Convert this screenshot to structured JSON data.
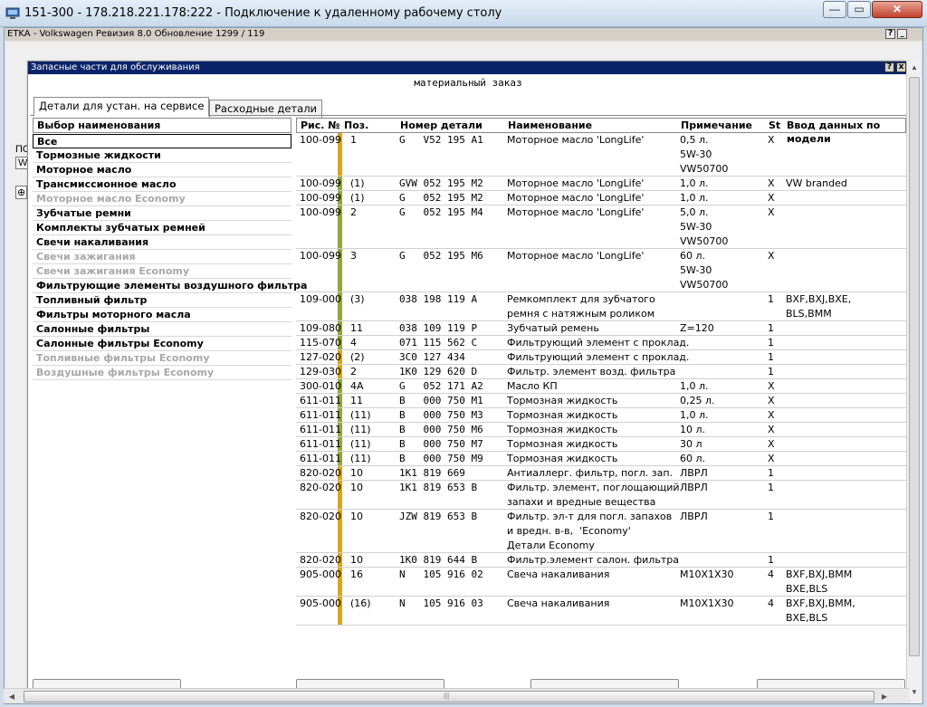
{
  "rdp": {
    "title": "151-300 - 178.218.221.178:222 - Подключение к удаленному рабочему столу",
    "buttons": {
      "minimize": "—",
      "maximize": "▭",
      "close": "✕"
    }
  },
  "etka": {
    "title": "ETKA - Volkswagen Ревизия 8.0 Обновление 1299 / 119",
    "help": "?",
    "minimize": "_",
    "bg_fragments": [
      "ПС",
      "W",
      "⊕"
    ]
  },
  "dialog": {
    "title": "Запасные части для обслуживания",
    "help": "?",
    "close": "x",
    "heading": "материальный заказ",
    "tabs": [
      {
        "label": "Детали для устан. на сервисе",
        "active": true
      },
      {
        "label": "Расходные детали",
        "active": false
      }
    ]
  },
  "left_list": {
    "header": "Выбор наименования",
    "items": [
      {
        "label": "Все",
        "state": "selected"
      },
      {
        "label": "Тормозные жидкости",
        "state": "normal"
      },
      {
        "label": "Моторное масло",
        "state": "normal"
      },
      {
        "label": "Трансмиссионное масло",
        "state": "normal"
      },
      {
        "label": "Моторное масло Economy",
        "state": "disabled"
      },
      {
        "label": "Зубчатые ремни",
        "state": "normal"
      },
      {
        "label": "Комплекты зубчатых ремней",
        "state": "normal"
      },
      {
        "label": "Свечи накаливания",
        "state": "normal"
      },
      {
        "label": "Свечи зажигания",
        "state": "disabled"
      },
      {
        "label": "Свечи зажигания Economy",
        "state": "disabled"
      },
      {
        "label": "Фильтрующие элементы воздушного фильтра",
        "state": "normal"
      },
      {
        "label": "Топливный фильтр",
        "state": "normal"
      },
      {
        "label": "Фильтры моторного масла",
        "state": "normal"
      },
      {
        "label": "Салонные фильтры",
        "state": "normal"
      },
      {
        "label": "Салонные фильтры Economy",
        "state": "normal"
      },
      {
        "label": "Топливные фильтры Economy",
        "state": "disabled"
      },
      {
        "label": "Воздушные фильтры Economy",
        "state": "disabled"
      }
    ]
  },
  "table": {
    "columns": [
      "Рис. №",
      "Поз.",
      "Номер детали",
      "Наименование",
      "Примечание",
      "St",
      "Ввод данных по модели"
    ],
    "rows": [
      {
        "fig": "100-099",
        "pos": "1",
        "bar": "orange",
        "part": "G   V52 195 A1",
        "name": "Моторное масло 'LongLife'",
        "note": "0,5 л.\n5W-30\nVW50700",
        "st": "X",
        "model": "",
        "lines": 3
      },
      {
        "fig": "100-099",
        "pos": "(1)",
        "bar": "green",
        "part": "GVW 052 195 M2",
        "name": "Моторное масло 'LongLife'",
        "note": "1,0 л.",
        "st": "X",
        "model": "VW branded",
        "lines": 1
      },
      {
        "fig": "100-099",
        "pos": "(1)",
        "bar": "green",
        "part": "G   052 195 M2",
        "name": "Моторное масло 'LongLife'",
        "note": "1,0 л.",
        "st": "X",
        "model": "",
        "lines": 1
      },
      {
        "fig": "100-099",
        "pos": "2",
        "bar": "green",
        "part": "G   052 195 M4",
        "name": "Моторное масло 'LongLife'",
        "note": "5,0 л.\n5W-30\nVW50700",
        "st": "X",
        "model": "",
        "lines": 3
      },
      {
        "fig": "100-099",
        "pos": "3",
        "bar": "green",
        "part": "G   052 195 M6",
        "name": "Моторное масло 'LongLife'",
        "note": "60 л.\n5W-30\nVW50700",
        "st": "X",
        "model": "",
        "lines": 3
      },
      {
        "fig": "109-000",
        "pos": "(3)",
        "bar": "green",
        "part": "038 198 119 A",
        "name": "Ремкомплект для зубчатого\nремня с натяжным роликом",
        "note": "",
        "st": "1",
        "model": "BXF,BXJ,BXE,\nBLS,BMM",
        "lines": 2
      },
      {
        "fig": "109-080",
        "pos": "11",
        "bar": "green",
        "part": "038 109 119 P",
        "name": "Зубчатый ремень",
        "note": "Z=120",
        "st": "1",
        "model": "",
        "lines": 1
      },
      {
        "fig": "115-070",
        "pos": "4",
        "bar": "green",
        "part": "071 115 562 C",
        "name": "Фильтрующий элемент с проклад.",
        "note": "",
        "st": "1",
        "model": "",
        "lines": 1
      },
      {
        "fig": "127-020",
        "pos": "(2)",
        "bar": "orange",
        "part": "3C0 127 434",
        "name": "Фильтрующий элемент с проклад.",
        "note": "",
        "st": "1",
        "model": "",
        "lines": 1
      },
      {
        "fig": "129-030",
        "pos": "2",
        "bar": "orange",
        "part": "1K0 129 620 D",
        "name": "Фильтр. элемент возд. фильтра",
        "note": "",
        "st": "1",
        "model": "",
        "lines": 1
      },
      {
        "fig": "300-010",
        "pos": "4A",
        "bar": "green",
        "part": "G   052 171 A2",
        "name": "Масло КП",
        "note": "1,0 л.",
        "st": "X",
        "model": "",
        "lines": 1
      },
      {
        "fig": "611-011",
        "pos": "11",
        "bar": "green",
        "part": "B   000 750 M1",
        "name": "Тормозная жидкость",
        "note": "0,25 л.",
        "st": "X",
        "model": "",
        "lines": 1
      },
      {
        "fig": "611-011",
        "pos": "(11)",
        "bar": "green",
        "part": "B   000 750 M3",
        "name": "Тормозная жидкость",
        "note": "1,0 л.",
        "st": "X",
        "model": "",
        "lines": 1
      },
      {
        "fig": "611-011",
        "pos": "(11)",
        "bar": "green",
        "part": "B   000 750 M6",
        "name": "Тормозная жидкость",
        "note": "10 л.",
        "st": "X",
        "model": "",
        "lines": 1
      },
      {
        "fig": "611-011",
        "pos": "(11)",
        "bar": "green",
        "part": "B   000 750 M7",
        "name": "Тормозная жидкость",
        "note": "30 л",
        "st": "X",
        "model": "",
        "lines": 1
      },
      {
        "fig": "611-011",
        "pos": "(11)",
        "bar": "green",
        "part": "B   000 750 M9",
        "name": "Тормозная жидкость",
        "note": "60 л.",
        "st": "X",
        "model": "",
        "lines": 1
      },
      {
        "fig": "820-020",
        "pos": "10",
        "bar": "orange",
        "part": "1K1 819 669",
        "name": "Антиаллерг. фильтр, погл. зап.",
        "note": "ЛВРЛ",
        "st": "1",
        "model": "",
        "lines": 1
      },
      {
        "fig": "820-020",
        "pos": "10",
        "bar": "orange",
        "part": "1K1 819 653 B",
        "name": "Фильтр. элемент, поглощающий\nзапахи и вредные вещества",
        "note": "ЛВРЛ",
        "st": "1",
        "model": "",
        "lines": 2
      },
      {
        "fig": "820-020",
        "pos": "10",
        "bar": "orange",
        "part": "JZW 819 653 B",
        "name": "Фильтр. эл-т для погл. запахов\nи вредн. в-в,  'Economy'\nДетали Economy",
        "note": "ЛВРЛ",
        "st": "1",
        "model": "",
        "lines": 3
      },
      {
        "fig": "820-020",
        "pos": "10",
        "bar": "orange",
        "part": "1K0 819 644 B",
        "name": "Фильтр.элемент салон. фильтра",
        "note": "",
        "st": "1",
        "model": "",
        "lines": 1
      },
      {
        "fig": "905-000",
        "pos": "16",
        "bar": "orange",
        "part": "N   105 916 02",
        "name": "Свеча накаливания",
        "note": "M10X1X30",
        "st": "4",
        "model": "BXF,BXJ,BMM\nBXE,BLS",
        "lines": 2
      },
      {
        "fig": "905-000",
        "pos": "(16)",
        "bar": "orange",
        "part": "N   105 916 03",
        "name": "Свеча накаливания",
        "note": "M10X1X30",
        "st": "4",
        "model": "BXF,BXJ,BMM,\nBXE,BLS",
        "lines": 2
      }
    ]
  },
  "colors": {
    "orange_bar": "#dca51a",
    "green_bar": "#8fa83b",
    "dialog_title": "#0a246a"
  }
}
